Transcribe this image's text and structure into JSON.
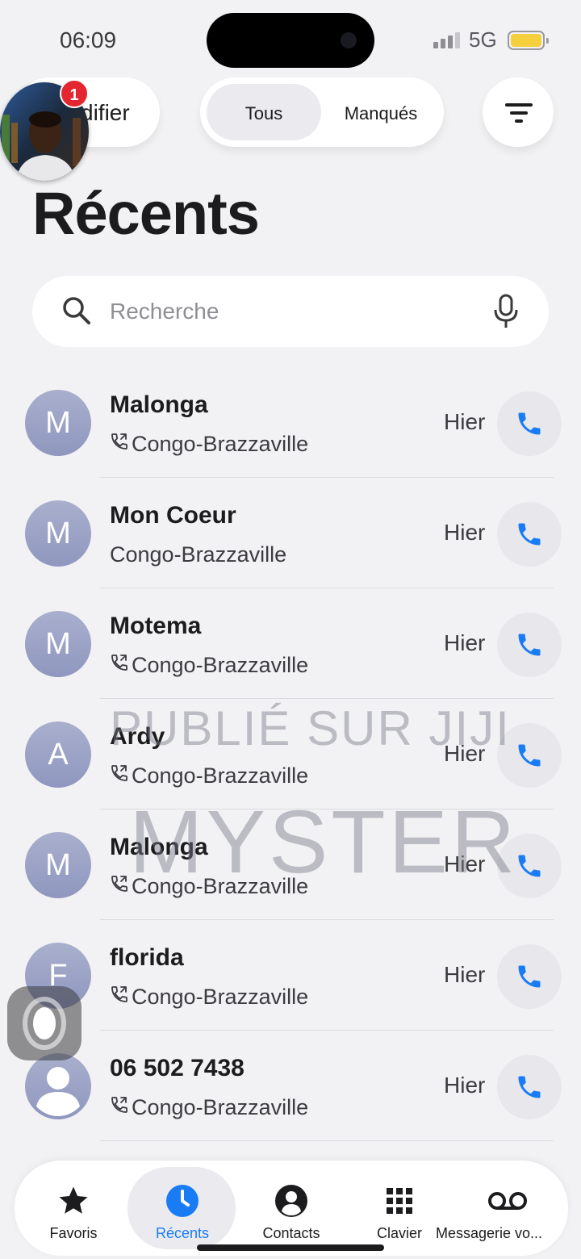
{
  "status_bar": {
    "time": "06:09",
    "network": "5G"
  },
  "header": {
    "edit_label": "difier",
    "badge_count": "1",
    "segments": {
      "all": "Tous",
      "missed": "Manqués"
    },
    "title": "Récents"
  },
  "search": {
    "placeholder": "Recherche"
  },
  "calls": [
    {
      "initial": "M",
      "name": "Malonga",
      "location": "Congo-Brazzaville",
      "time": "Hier",
      "has_call_icon": true
    },
    {
      "initial": "M",
      "name": "Mon Coeur",
      "location": "Congo-Brazzaville",
      "time": "Hier",
      "has_call_icon": false
    },
    {
      "initial": "M",
      "name": "Motema",
      "location": "Congo-Brazzaville",
      "time": "Hier",
      "has_call_icon": true
    },
    {
      "initial": "A",
      "name": "Ardy",
      "location": "Congo-Brazzaville",
      "time": "Hier",
      "has_call_icon": true
    },
    {
      "initial": "M",
      "name": "Malonga",
      "location": "Congo-Brazzaville",
      "time": "Hier",
      "has_call_icon": true
    },
    {
      "initial": "F",
      "name": "florida",
      "location": "Congo-Brazzaville",
      "time": "Hier",
      "has_call_icon": true
    },
    {
      "initial": "",
      "name": "06 502 7438",
      "location": "Congo-Brazzaville",
      "time": "Hier",
      "has_call_icon": true
    }
  ],
  "watermark": {
    "line1": "PUBLIÉ SUR JIJI",
    "line2": "MYSTER"
  },
  "tabs": [
    {
      "label": "Favoris",
      "icon": "star-icon"
    },
    {
      "label": "Récents",
      "icon": "clock-icon",
      "active": true
    },
    {
      "label": "Contacts",
      "icon": "person-circle-icon"
    },
    {
      "label": "Clavier",
      "icon": "keypad-icon"
    },
    {
      "label": "Messagerie vo...",
      "icon": "voicemail-icon"
    }
  ],
  "colors": {
    "accent": "#1a7cf5",
    "badge": "#e3262f",
    "avatar": "#9ea5c8",
    "background": "#f2f2f4"
  }
}
